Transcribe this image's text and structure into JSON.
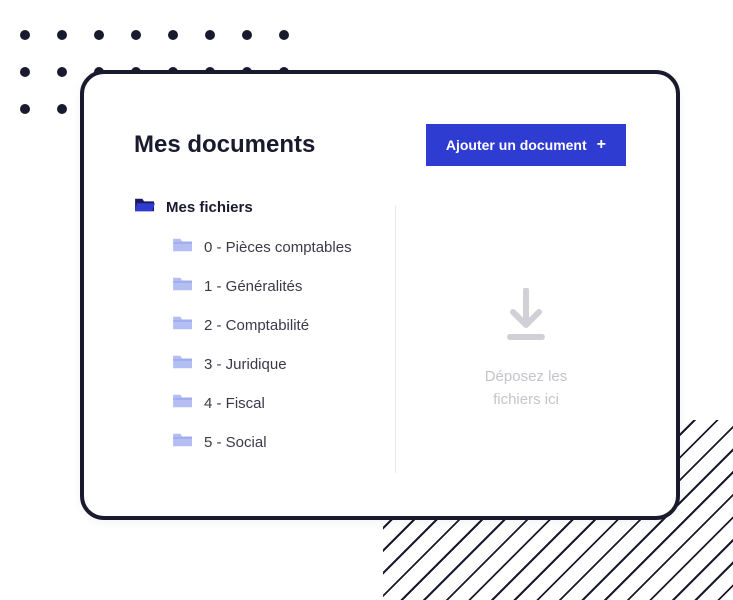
{
  "header": {
    "title": "Mes documents",
    "add_button_label": "Ajouter un document"
  },
  "tree": {
    "root_label": "Mes fichiers",
    "items": [
      {
        "label": "0 - Pièces comptables"
      },
      {
        "label": "1 - Généralités"
      },
      {
        "label": "2 - Comptabilité"
      },
      {
        "label": "3 - Juridique"
      },
      {
        "label": "4 - Fiscal"
      },
      {
        "label": "5 - Social"
      }
    ]
  },
  "dropzone": {
    "text": "Déposez les fichiers ici"
  }
}
